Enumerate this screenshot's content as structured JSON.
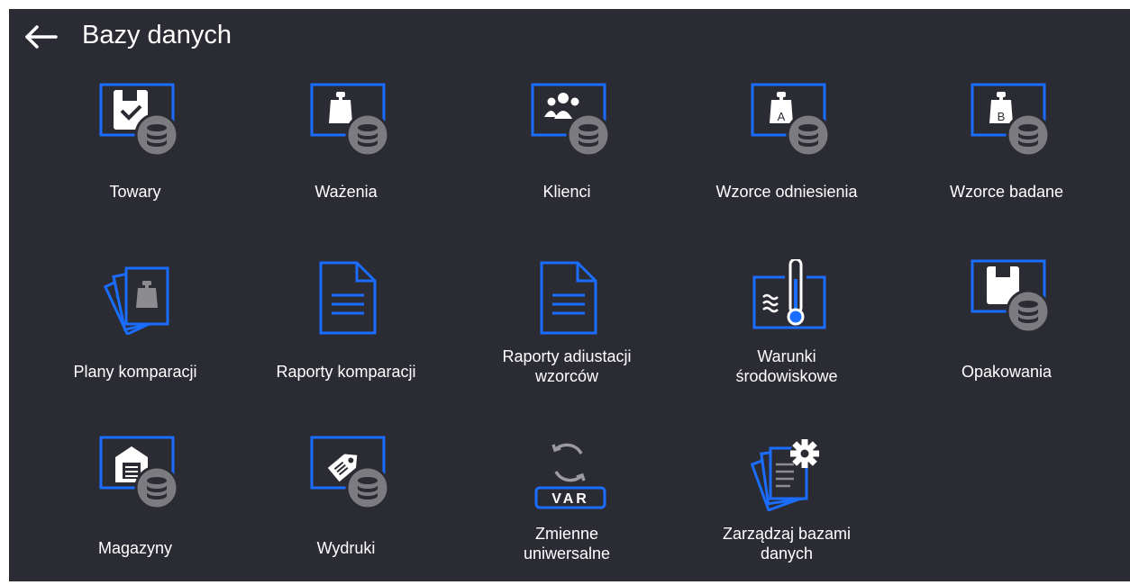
{
  "header": {
    "title": "Bazy danych",
    "back_icon": "back-arrow-icon"
  },
  "colors": {
    "background": "#2b2b33",
    "accent": "#1a6dff",
    "badge": "#7c7c80",
    "text": "#ffffff"
  },
  "tiles": [
    {
      "label": "Towary",
      "icon": "products-database-icon"
    },
    {
      "label": "Ważenia",
      "icon": "weighings-database-icon"
    },
    {
      "label": "Klienci",
      "icon": "customers-database-icon"
    },
    {
      "label": "Wzorce odniesienia",
      "icon": "reference-standards-database-icon"
    },
    {
      "label": "Wzorce badane",
      "icon": "tested-standards-database-icon"
    },
    {
      "label": "Plany komparacji",
      "icon": "comparison-plans-icon"
    },
    {
      "label": "Raporty komparacji",
      "icon": "comparison-reports-icon"
    },
    {
      "label_line1": "Raporty adiustacji",
      "label_line2": "wzorców",
      "icon": "adjustment-reports-icon"
    },
    {
      "label_line1": "Warunki",
      "label_line2": "środowiskowe",
      "icon": "ambient-conditions-icon"
    },
    {
      "label": "Opakowania",
      "icon": "packaging-database-icon"
    },
    {
      "label": "Magazyny",
      "icon": "warehouses-database-icon"
    },
    {
      "label": "Wydruki",
      "icon": "printouts-database-icon"
    },
    {
      "label_line1": "Zmienne",
      "label_line2": "uniwersalne",
      "icon": "universal-variables-icon",
      "badge": "VAR"
    },
    {
      "label_line1": "Zarządzaj bazami",
      "label_line2": "danych",
      "icon": "manage-databases-icon"
    }
  ]
}
